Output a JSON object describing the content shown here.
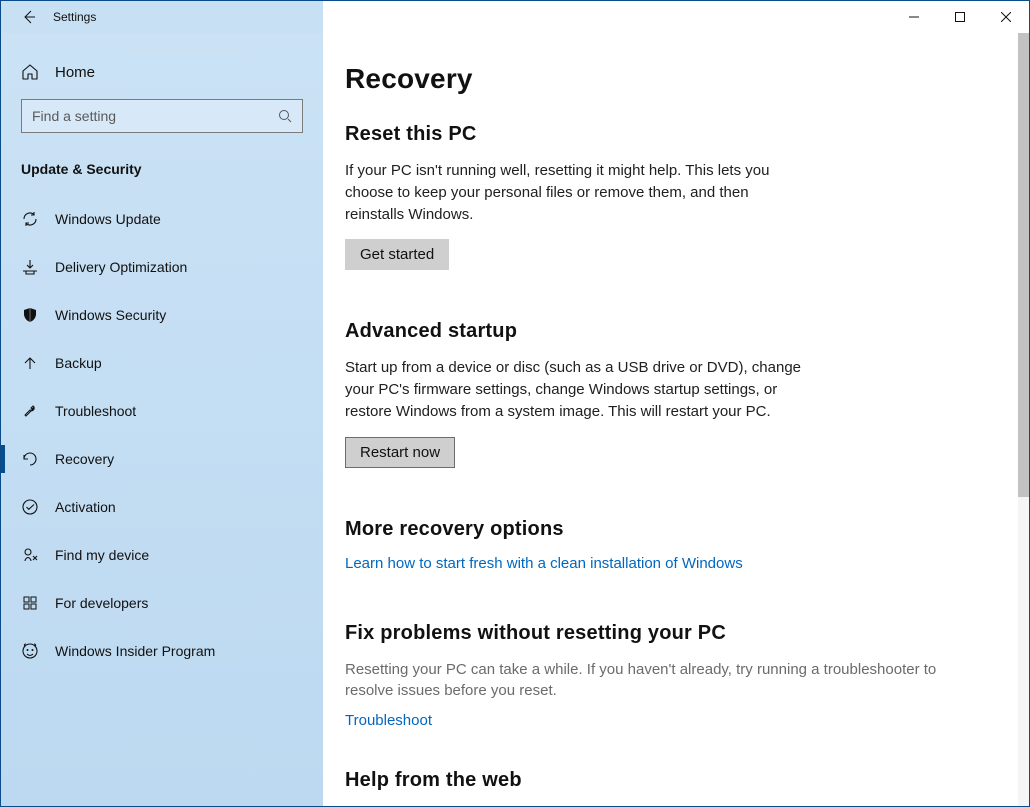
{
  "titlebar": {
    "title": "Settings"
  },
  "sidebar": {
    "home": "Home",
    "search_placeholder": "Find a setting",
    "section": "Update & Security",
    "items": [
      {
        "icon": "sync-icon",
        "label": "Windows Update"
      },
      {
        "icon": "download-icon",
        "label": "Delivery Optimization"
      },
      {
        "icon": "shield-icon",
        "label": "Windows Security"
      },
      {
        "icon": "arrow-up-icon",
        "label": "Backup"
      },
      {
        "icon": "wrench-icon",
        "label": "Troubleshoot"
      },
      {
        "icon": "recovery-icon",
        "label": "Recovery",
        "active": true
      },
      {
        "icon": "check-circle-icon",
        "label": "Activation"
      },
      {
        "icon": "find-device-icon",
        "label": "Find my device"
      },
      {
        "icon": "developers-icon",
        "label": "For developers"
      },
      {
        "icon": "insider-icon",
        "label": "Windows Insider Program"
      }
    ]
  },
  "main": {
    "title": "Recovery",
    "reset": {
      "heading": "Reset this PC",
      "desc": "If your PC isn't running well, resetting it might help. This lets you choose to keep your personal files or remove them, and then reinstalls Windows.",
      "button": "Get started"
    },
    "advanced": {
      "heading": "Advanced startup",
      "desc": "Start up from a device or disc (such as a USB drive or DVD), change your PC's firmware settings, change Windows startup settings, or restore Windows from a system image. This will restart your PC.",
      "button": "Restart now"
    },
    "more": {
      "heading": "More recovery options",
      "link": "Learn how to start fresh with a clean installation of Windows"
    },
    "fix": {
      "heading": "Fix problems without resetting your PC",
      "desc": "Resetting your PC can take a while. If you haven't already, try running a troubleshooter to resolve issues before you reset.",
      "link": "Troubleshoot"
    },
    "help": {
      "heading": "Help from the web"
    }
  }
}
